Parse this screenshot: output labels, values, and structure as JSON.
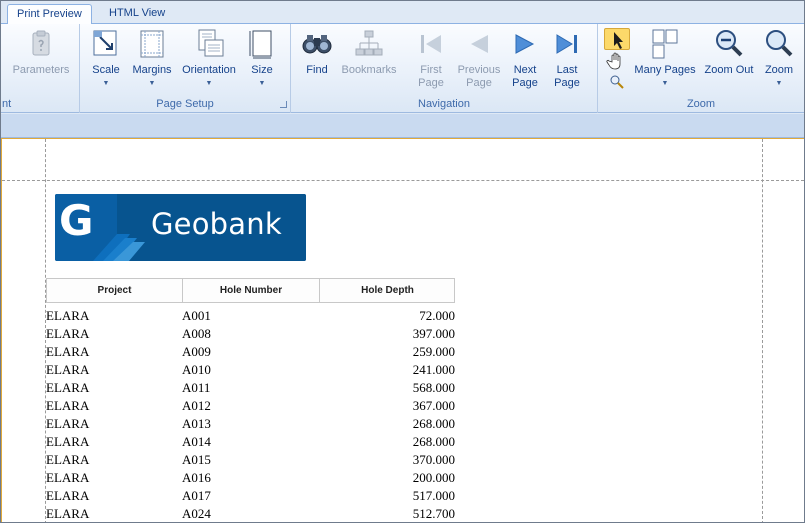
{
  "tabs": [
    {
      "label": "Print Preview"
    },
    {
      "label": "HTML View"
    }
  ],
  "ribbon": {
    "groups": {
      "partial_label": "nt",
      "page_setup": "Page Setup",
      "navigation": "Navigation",
      "zoom": "Zoom"
    },
    "buttons": {
      "parameters": "Parameters",
      "scale": "Scale",
      "margins": "Margins",
      "orientation": "Orientation",
      "size": "Size",
      "find": "Find",
      "bookmarks": "Bookmarks",
      "first_page": "First Page",
      "previous_page": "Previous Page",
      "next_page": "Next Page",
      "last_page": "Last Page",
      "many_pages": "Many Pages",
      "zoom_out": "Zoom Out",
      "zoom": "Zoom"
    }
  },
  "report": {
    "logo_letter": "G",
    "logo_text": "Geobank",
    "columns": [
      "Project",
      "Hole Number",
      "Hole Depth"
    ],
    "rows": [
      [
        "ELARA",
        "A001",
        "72.000"
      ],
      [
        "ELARA",
        "A008",
        "397.000"
      ],
      [
        "ELARA",
        "A009",
        "259.000"
      ],
      [
        "ELARA",
        "A010",
        "241.000"
      ],
      [
        "ELARA",
        "A011",
        "568.000"
      ],
      [
        "ELARA",
        "A012",
        "367.000"
      ],
      [
        "ELARA",
        "A013",
        "268.000"
      ],
      [
        "ELARA",
        "A014",
        "268.000"
      ],
      [
        "ELARA",
        "A015",
        "370.000"
      ],
      [
        "ELARA",
        "A016",
        "200.000"
      ],
      [
        "ELARA",
        "A017",
        "517.000"
      ],
      [
        "ELARA",
        "A024",
        "512.700"
      ]
    ]
  },
  "colors": {
    "accent": "#15428b",
    "logo_blue": "#0a5fa4",
    "preview_border": "#e0a93b"
  }
}
